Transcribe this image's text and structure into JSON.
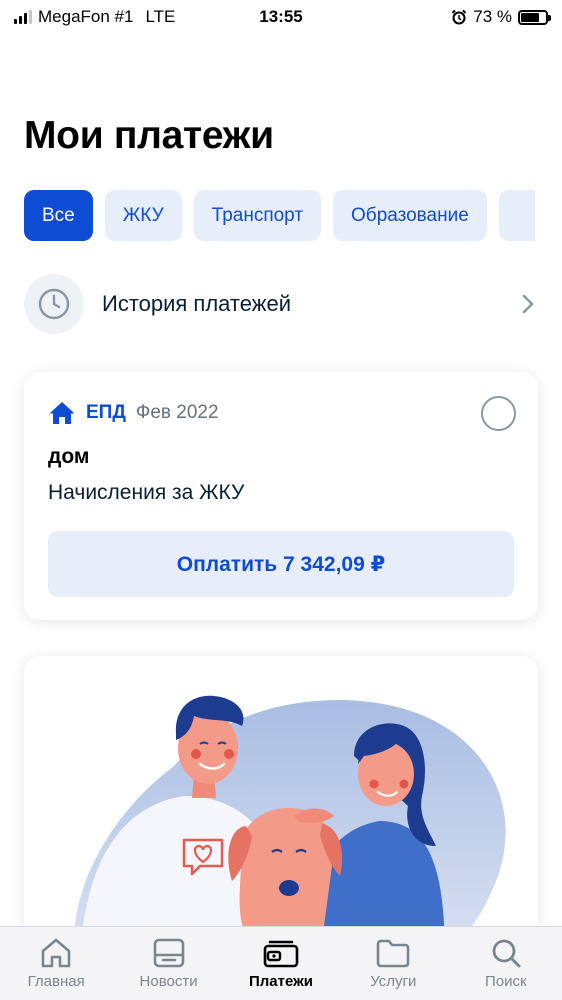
{
  "status_bar": {
    "carrier": "MegaFon #1",
    "network": "LTE",
    "time": "13:55",
    "battery": "73 %",
    "battery_level": 0.73
  },
  "title": "Мои платежи",
  "filters": [
    {
      "label": "Все",
      "active": true
    },
    {
      "label": "ЖКУ",
      "active": false
    },
    {
      "label": "Транспорт",
      "active": false
    },
    {
      "label": "Образование",
      "active": false
    }
  ],
  "history": {
    "label": "История платежей",
    "icon": "clock-icon"
  },
  "payment_card": {
    "tag": "ЕПД",
    "date": "Фев 2022",
    "title": "дом",
    "description": "Начисления за ЖКУ",
    "pay_label": "Оплатить 7 342,09 ₽",
    "icon": "house-icon"
  },
  "tab_bar": [
    {
      "label": "Главная",
      "icon": "home-icon",
      "active": false
    },
    {
      "label": "Новости",
      "icon": "news-icon",
      "active": false
    },
    {
      "label": "Платежи",
      "icon": "wallet-icon",
      "active": true
    },
    {
      "label": "Услуги",
      "icon": "folder-icon",
      "active": false
    },
    {
      "label": "Поиск",
      "icon": "search-icon",
      "active": false
    }
  ],
  "colors": {
    "accent": "#0d4cd3",
    "chip_bg": "#e8eef9",
    "illustration_blob": "#a9bde3"
  }
}
